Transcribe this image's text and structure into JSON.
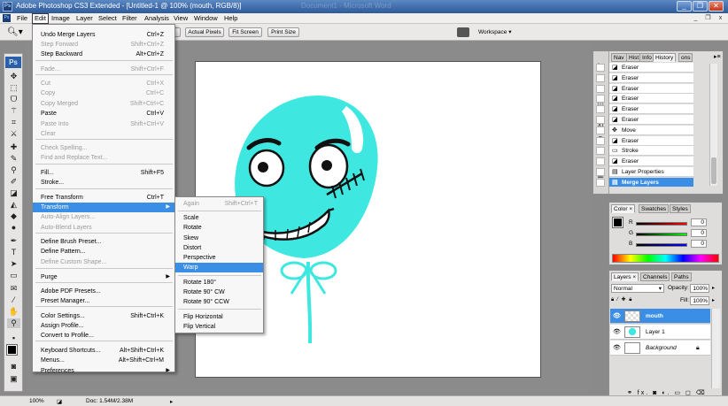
{
  "window": {
    "title": "Adobe Photoshop CS3 Extended - [Untitled-1 @ 100% (mouth, RGB/8)]",
    "ghost_title": "Document1 - Microsoft Word",
    "minimize": "_",
    "restore": "❐",
    "close": "✕"
  },
  "menubar": {
    "items": [
      "File",
      "Edit",
      "Image",
      "Layer",
      "Select",
      "Filter",
      "Analysis",
      "View",
      "Window",
      "Help"
    ],
    "active": "Edit",
    "doc_min": "_",
    "doc_restore": "❐",
    "doc_close": "x"
  },
  "options": {
    "actual_pixels": "Actual Pixels",
    "fit_screen": "Fit Screen",
    "print_size": "Print Size",
    "workspace": "Workspace ▾"
  },
  "edit_menu": [
    {
      "label": "Undo Merge Layers",
      "shortcut": "Ctrl+Z",
      "disabled": false
    },
    {
      "label": "Step Forward",
      "shortcut": "Shift+Ctrl+Z",
      "disabled": true
    },
    {
      "label": "Step Backward",
      "shortcut": "Alt+Ctrl+Z",
      "disabled": false
    },
    {
      "label": "Fade...",
      "shortcut": "Shift+Ctrl+F",
      "disabled": true
    },
    {
      "label": "Cut",
      "shortcut": "Ctrl+X",
      "disabled": true
    },
    {
      "label": "Copy",
      "shortcut": "Ctrl+C",
      "disabled": true
    },
    {
      "label": "Copy Merged",
      "shortcut": "Shift+Ctrl+C",
      "disabled": true
    },
    {
      "label": "Paste",
      "shortcut": "Ctrl+V",
      "disabled": false
    },
    {
      "label": "Paste Into",
      "shortcut": "Shift+Ctrl+V",
      "disabled": true
    },
    {
      "label": "Clear",
      "shortcut": "",
      "disabled": true
    },
    {
      "label": "Check Spelling...",
      "shortcut": "",
      "disabled": true
    },
    {
      "label": "Find and Replace Text...",
      "shortcut": "",
      "disabled": true
    },
    {
      "label": "Fill...",
      "shortcut": "Shift+F5",
      "disabled": false
    },
    {
      "label": "Stroke...",
      "shortcut": "",
      "disabled": false
    },
    {
      "label": "Free Transform",
      "shortcut": "Ctrl+T",
      "disabled": false
    },
    {
      "label": "Transform",
      "shortcut": "",
      "disabled": false,
      "submenu": true
    },
    {
      "label": "Auto-Align Layers...",
      "shortcut": "",
      "disabled": true
    },
    {
      "label": "Auto-Blend Layers",
      "shortcut": "",
      "disabled": true
    },
    {
      "label": "Define Brush Preset...",
      "shortcut": "",
      "disabled": false
    },
    {
      "label": "Define Pattern...",
      "shortcut": "",
      "disabled": false
    },
    {
      "label": "Define Custom Shape...",
      "shortcut": "",
      "disabled": true
    },
    {
      "label": "Purge",
      "shortcut": "",
      "disabled": false,
      "submenu": true
    },
    {
      "label": "Adobe PDF Presets...",
      "shortcut": "",
      "disabled": false
    },
    {
      "label": "Preset Manager...",
      "shortcut": "",
      "disabled": false
    },
    {
      "label": "Color Settings...",
      "shortcut": "Shift+Ctrl+K",
      "disabled": false
    },
    {
      "label": "Assign Profile...",
      "shortcut": "",
      "disabled": false
    },
    {
      "label": "Convert to Profile...",
      "shortcut": "",
      "disabled": false
    },
    {
      "label": "Keyboard Shortcuts...",
      "shortcut": "Alt+Shift+Ctrl+K",
      "disabled": false
    },
    {
      "label": "Menus...",
      "shortcut": "Alt+Shift+Ctrl+M",
      "disabled": false
    },
    {
      "label": "Preferences",
      "shortcut": "",
      "disabled": false,
      "submenu": true
    }
  ],
  "transform_menu": [
    {
      "label": "Again",
      "shortcut": "Shift+Ctrl+T",
      "disabled": true
    },
    {
      "label": "Scale",
      "shortcut": "",
      "disabled": false
    },
    {
      "label": "Rotate",
      "shortcut": "",
      "disabled": false
    },
    {
      "label": "Skew",
      "shortcut": "",
      "disabled": false
    },
    {
      "label": "Distort",
      "shortcut": "",
      "disabled": false
    },
    {
      "label": "Perspective",
      "shortcut": "",
      "disabled": false
    },
    {
      "label": "Warp",
      "shortcut": "",
      "disabled": false
    },
    {
      "label": "Rotate 180°",
      "shortcut": "",
      "disabled": false
    },
    {
      "label": "Rotate 90° CW",
      "shortcut": "",
      "disabled": false
    },
    {
      "label": "Rotate 90° CCW",
      "shortcut": "",
      "disabled": false
    },
    {
      "label": "Flip Horizontal",
      "shortcut": "",
      "disabled": false
    },
    {
      "label": "Flip Vertical",
      "shortcut": "",
      "disabled": false
    }
  ],
  "history": {
    "tabs": [
      "Nav",
      "Hist",
      "Info",
      "History",
      "ons"
    ],
    "items": [
      "Eraser",
      "Eraser",
      "Eraser",
      "Eraser",
      "Eraser",
      "Eraser",
      "Move",
      "Eraser",
      "Stroke",
      "Eraser",
      "Layer Properties",
      "Merge Layers"
    ],
    "selected": "Merge Layers"
  },
  "color": {
    "tabs": [
      "Color ×",
      "Swatches",
      "Styles"
    ],
    "r": "0",
    "g": "0",
    "b": "0",
    "labels": {
      "r": "R",
      "g": "G",
      "b": "B"
    }
  },
  "layers": {
    "tabs": [
      "Layers ×",
      "Channels",
      "Paths"
    ],
    "blend": "Normal",
    "opacity_label": "Opacity:",
    "opacity": "100%",
    "fill_label": "Fill:",
    "fill": "100%",
    "items": [
      "mouth",
      "Layer 1",
      "Background"
    ],
    "footer_icons": "⚭ fx. ◙ ◐. ▭ ◻ ⌫"
  },
  "status": {
    "zoom": "100%",
    "doc": "Doc: 1.54M/2.38M"
  },
  "colors": {
    "balloon": "#3ee8e0",
    "highlight": "#3a8ee6",
    "title_bar": "#2e5a99"
  }
}
